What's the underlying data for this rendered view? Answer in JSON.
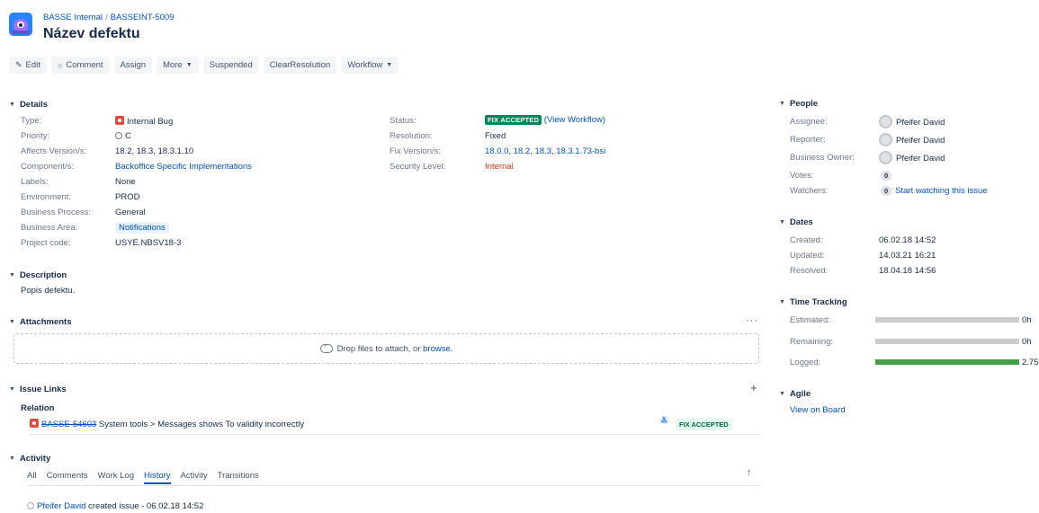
{
  "breadcrumb": {
    "project": "BASSE Internal",
    "separator": "/",
    "issue_key": "BASSEINT-5009"
  },
  "issue": {
    "summary": "Název defektu"
  },
  "toolbar": {
    "edit": "Edit",
    "comment": "Comment",
    "assign": "Assign",
    "more": "More",
    "suspended": "Suspended",
    "clear_resolution": "ClearResolution",
    "workflow": "Workflow"
  },
  "details": {
    "title": "Details",
    "type_label": "Type:",
    "type_value": "Internal Bug",
    "priority_label": "Priority:",
    "priority_value": "C",
    "affects_label": "Affects Version/s:",
    "affects_value": "18.2, 18.3, 18.3.1.10",
    "component_label": "Component/s:",
    "component_value": "Backoffice Specific Implementations",
    "labels_label": "Labels:",
    "labels_value": "None",
    "environment_label": "Environment:",
    "environment_value": "PROD",
    "bprocess_label": "Business Process:",
    "bprocess_value": "General",
    "barea_label": "Business Area:",
    "barea_value": "Notifications",
    "pcode_label": "Project code:",
    "pcode_value": "USYE.NBSV18-3",
    "status_label": "Status:",
    "status_value": "FIX ACCEPTED",
    "view_workflow": "(View Workflow)",
    "resolution_label": "Resolution:",
    "resolution_value": "Fixed",
    "fixver_label": "Fix Version/s:",
    "fixver_values": [
      "18.0.0",
      "18.2",
      "18.3",
      "18.3.1.73-bsi"
    ],
    "fixver_sep": ", ",
    "security_label": "Security Level:",
    "security_value": "Internal"
  },
  "description": {
    "title": "Description",
    "text": "Popis defektu."
  },
  "attachments": {
    "title": "Attachments",
    "drop_text": "Drop files to attach, or",
    "browse": "browse."
  },
  "issue_links": {
    "title": "Issue Links",
    "group": "Relation",
    "link_key": "BASSE-54603",
    "link_summary": "System tools > Messages shows To validity incorrectly",
    "link_status": "FIX ACCEPTED"
  },
  "activity": {
    "title": "Activity",
    "tabs": [
      "All",
      "Comments",
      "Work Log",
      "History",
      "Activity",
      "Transitions"
    ],
    "active_tab": "History",
    "entry_user": "Pfeifer David",
    "entry_text": "created issue - 06.02.18 14:52"
  },
  "people": {
    "title": "People",
    "assignee_label": "Assignee:",
    "assignee": "Pfeifer David",
    "reporter_label": "Reporter:",
    "reporter": "Pfeifer David",
    "owner_label": "Business Owner:",
    "owner": "Pfeifer David",
    "votes_label": "Votes:",
    "votes": "0",
    "watchers_label": "Watchers:",
    "watchers": "0",
    "watch_link": "Start watching this issue"
  },
  "dates": {
    "title": "Dates",
    "created_label": "Created:",
    "created": "06.02.18 14:52",
    "updated_label": "Updated:",
    "updated": "14.03.21 16:21",
    "resolved_label": "Resolved:",
    "resolved": "18.04.18 14:56"
  },
  "time_tracking": {
    "title": "Time Tracking",
    "estimated_label": "Estimated:",
    "estimated": "0h",
    "remaining_label": "Remaining:",
    "remaining": "0h",
    "logged_label": "Logged:",
    "logged": "2.75",
    "logged_fill": 1.0
  },
  "agile": {
    "title": "Agile",
    "link": "View on Board"
  },
  "colors": {
    "link": "#0052cc",
    "status_green": "#00875a",
    "bug_red": "#e5493a",
    "bar_gray": "#cccccc",
    "bar_green": "#43a047",
    "security_red": "#de350b"
  },
  "icons": {
    "edit": "pencil-icon",
    "comment": "comment-icon",
    "more": "chevron-down-icon",
    "section": "chevron-down-icon",
    "attach": "cloud-upload-icon",
    "add_link": "plus-icon",
    "attach_menu": "more-dots-icon",
    "sort": "arrow-up-icon"
  }
}
